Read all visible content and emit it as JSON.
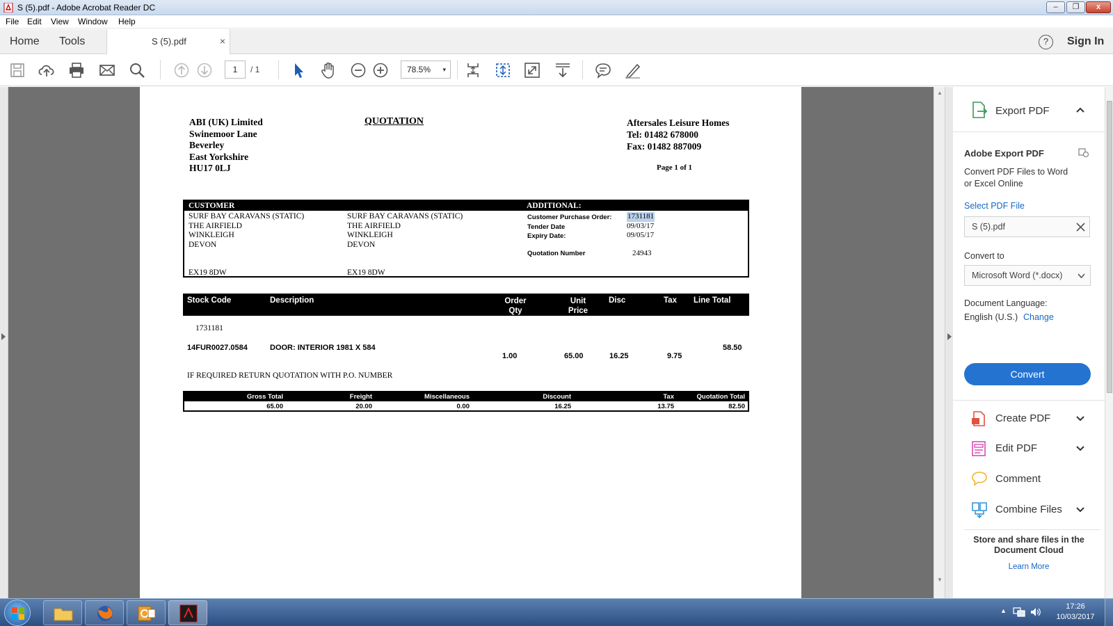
{
  "window": {
    "title": "S (5).pdf - Adobe Acrobat Reader DC",
    "minimize_icon": "minimize-icon",
    "maximize_icon": "maximize-icon",
    "close_label": "x"
  },
  "menu": [
    "File",
    "Edit",
    "View",
    "Window",
    "Help"
  ],
  "tabs": {
    "home": "Home",
    "tools": "Tools",
    "document": "S (5).pdf",
    "close": "×",
    "help_icon": "?",
    "sign_in": "Sign In"
  },
  "toolbar": {
    "page_current": "1",
    "page_total": "/ 1",
    "zoom": "78.5%",
    "zoom_arrow": "▾",
    "icons": [
      "save-icon",
      "upload-icon",
      "print-icon",
      "email-icon",
      "search-icon",
      "prev-page-icon",
      "next-page-icon",
      "select-cursor-icon",
      "hand-icon",
      "zoom-out-icon",
      "zoom-in-icon",
      "fit-page-icon",
      "rotate-icon",
      "full-screen-icon",
      "read-mode-icon",
      "comment-icon",
      "sign-icon"
    ]
  },
  "document": {
    "sender": [
      "ABI (UK) Limited",
      "Swinemoor Lane",
      "Beverley",
      "East Yorkshire",
      "HU17 0LJ"
    ],
    "doc_title": "QUOTATION",
    "company": [
      "Aftersales Leisure Homes",
      "Tel: 01482 678000",
      "Fax: 01482 887009"
    ],
    "page_info": "Page 1 of 1",
    "customer_header": "CUSTOMER",
    "additional_header": "ADDITIONAL:",
    "bill_to": [
      "SURF BAY CARAVANS (STATIC)",
      "THE AIRFIELD",
      "WINKLEIGH",
      "DEVON"
    ],
    "bill_postcode": "EX19 8DW",
    "ship_to": [
      "SURF BAY CARAVANS (STATIC)",
      "THE AIRFIELD",
      "WINKLEIGH",
      "DEVON"
    ],
    "ship_postcode": "EX19 8DW",
    "additional": {
      "po_label": "Customer Purchase Order:",
      "po_value": "1731181",
      "tender_label": "Tender Date",
      "tender_value": "09/03/17",
      "expiry_label": "Expiry Date:",
      "expiry_value": "09/05/17",
      "quote_label": "Quotation Number",
      "quote_value": "24943"
    },
    "lines_header": {
      "stock_code": "Stock Code",
      "description": "Description",
      "order_qty_1": "Order",
      "order_qty_2": "Qty",
      "unit_price_1": "Unit",
      "unit_price_2": "Price",
      "disc": "Disc",
      "tax": "Tax",
      "line_total": "Line Total"
    },
    "reference": "1731181",
    "line": {
      "stock_code": "14FUR0027.0584",
      "description": "DOOR: INTERIOR 1981 X 584",
      "qty": "1.00",
      "unit_price": "65.00",
      "disc": "16.25",
      "tax": "9.75",
      "line_total": "58.50"
    },
    "note": "IF REQUIRED RETURN QUOTATION WITH P.O. NUMBER",
    "totals_header": {
      "gross": "Gross Total",
      "freight": "Freight",
      "misc": "Miscellaneous",
      "discount": "Discount",
      "tax": "Tax",
      "total": "Quotation Total"
    },
    "totals": {
      "gross": "65.00",
      "freight": "20.00",
      "misc": "0.00",
      "discount": "16.25",
      "tax": "13.75",
      "total": "82.50"
    }
  },
  "right_pane": {
    "export_title": "Export PDF",
    "section_title": "Adobe Export PDF",
    "description_1": "Convert PDF Files to Word",
    "description_2": "or Excel Online",
    "select_file": "Select PDF File",
    "file_name": "S (5).pdf",
    "convert_to": "Convert to",
    "format": "Microsoft Word (*.docx)",
    "doc_language": "Document Language:",
    "language": "English (U.S.)",
    "change": "Change",
    "convert_button": "Convert",
    "tools": [
      "Create PDF",
      "Edit PDF",
      "Comment",
      "Combine Files"
    ],
    "cloud_1": "Store and share files in the",
    "cloud_2": "Document Cloud",
    "learn_more": "Learn More"
  },
  "taskbar": {
    "time": "17:26",
    "date": "10/03/2017"
  },
  "colors": {
    "accent": "#2473d1",
    "link": "#1468c7",
    "highlight": "#b9d1ea"
  }
}
